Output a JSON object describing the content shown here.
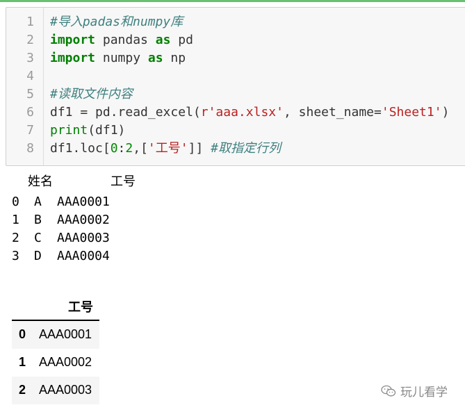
{
  "notebook": {
    "code_cell": {
      "line_numbers": [
        "1",
        "2",
        "3",
        "4",
        "5",
        "6",
        "7",
        "8"
      ],
      "lines": [
        [
          {
            "t": "#导入padas和numpy库",
            "k": "cmt"
          }
        ],
        [
          {
            "t": "import",
            "k": "kw"
          },
          {
            "t": " pandas ",
            "k": ""
          },
          {
            "t": "as",
            "k": "kw"
          },
          {
            "t": " pd",
            "k": ""
          }
        ],
        [
          {
            "t": "import",
            "k": "kw"
          },
          {
            "t": " numpy ",
            "k": ""
          },
          {
            "t": "as",
            "k": "kw"
          },
          {
            "t": " np",
            "k": ""
          }
        ],
        [],
        [
          {
            "t": "#读取文件内容",
            "k": "cmt"
          }
        ],
        [
          {
            "t": "df1 = pd.read_excel(",
            "k": ""
          },
          {
            "t": "r'aaa.xlsx'",
            "k": "str"
          },
          {
            "t": ", sheet_name=",
            "k": ""
          },
          {
            "t": "'Sheet1'",
            "k": "str"
          },
          {
            "t": ")",
            "k": ""
          }
        ],
        [
          {
            "t": "print",
            "k": "builtin"
          },
          {
            "t": "(df1)",
            "k": ""
          }
        ],
        [
          {
            "t": "df1.loc[",
            "k": ""
          },
          {
            "t": "0",
            "k": "num"
          },
          {
            "t": ":",
            "k": ""
          },
          {
            "t": "2",
            "k": "num"
          },
          {
            "t": ",[",
            "k": ""
          },
          {
            "t": "'工号'",
            "k": "str"
          },
          {
            "t": "]] ",
            "k": ""
          },
          {
            "t": "#取指定行列",
            "k": "cmt"
          }
        ]
      ]
    },
    "print_output": {
      "header": [
        "姓名",
        "工号"
      ],
      "rows": [
        [
          "0",
          "A",
          "AAA0001"
        ],
        [
          "1",
          "B",
          "AAA0002"
        ],
        [
          "2",
          "C",
          "AAA0003"
        ],
        [
          "3",
          "D",
          "AAA0004"
        ]
      ]
    },
    "dataframe_output": {
      "column": "工号",
      "rows": [
        {
          "index": "0",
          "value": "AAA0001"
        },
        {
          "index": "1",
          "value": "AAA0002"
        },
        {
          "index": "2",
          "value": "AAA0003"
        }
      ]
    }
  },
  "watermark": {
    "icon": "wechat-icon",
    "text": "玩儿看学"
  }
}
